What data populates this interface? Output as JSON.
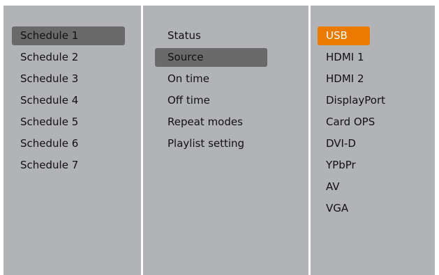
{
  "menu": {
    "schedules": {
      "items": [
        "Schedule 1",
        "Schedule 2",
        "Schedule 3",
        "Schedule 4",
        "Schedule 5",
        "Schedule 6",
        "Schedule 7"
      ],
      "selected": "Schedule 1"
    },
    "settings": {
      "items": [
        "Status",
        "Source",
        "On time",
        "Off time",
        "Repeat modes",
        "Playlist setting"
      ],
      "selected": "Source"
    },
    "sources": {
      "items": [
        "USB",
        "HDMI 1",
        "HDMI 2",
        "DisplayPort",
        "Card OPS",
        "DVI-D",
        "YPbPr",
        "AV",
        "VGA"
      ],
      "selected": "USB"
    }
  },
  "colors": {
    "panel_bg": "#b2b3b7",
    "divider": "#ffffff",
    "selection_gray": "#6a6a6b",
    "selection_active": "#ea7a00",
    "text": "#111111"
  }
}
